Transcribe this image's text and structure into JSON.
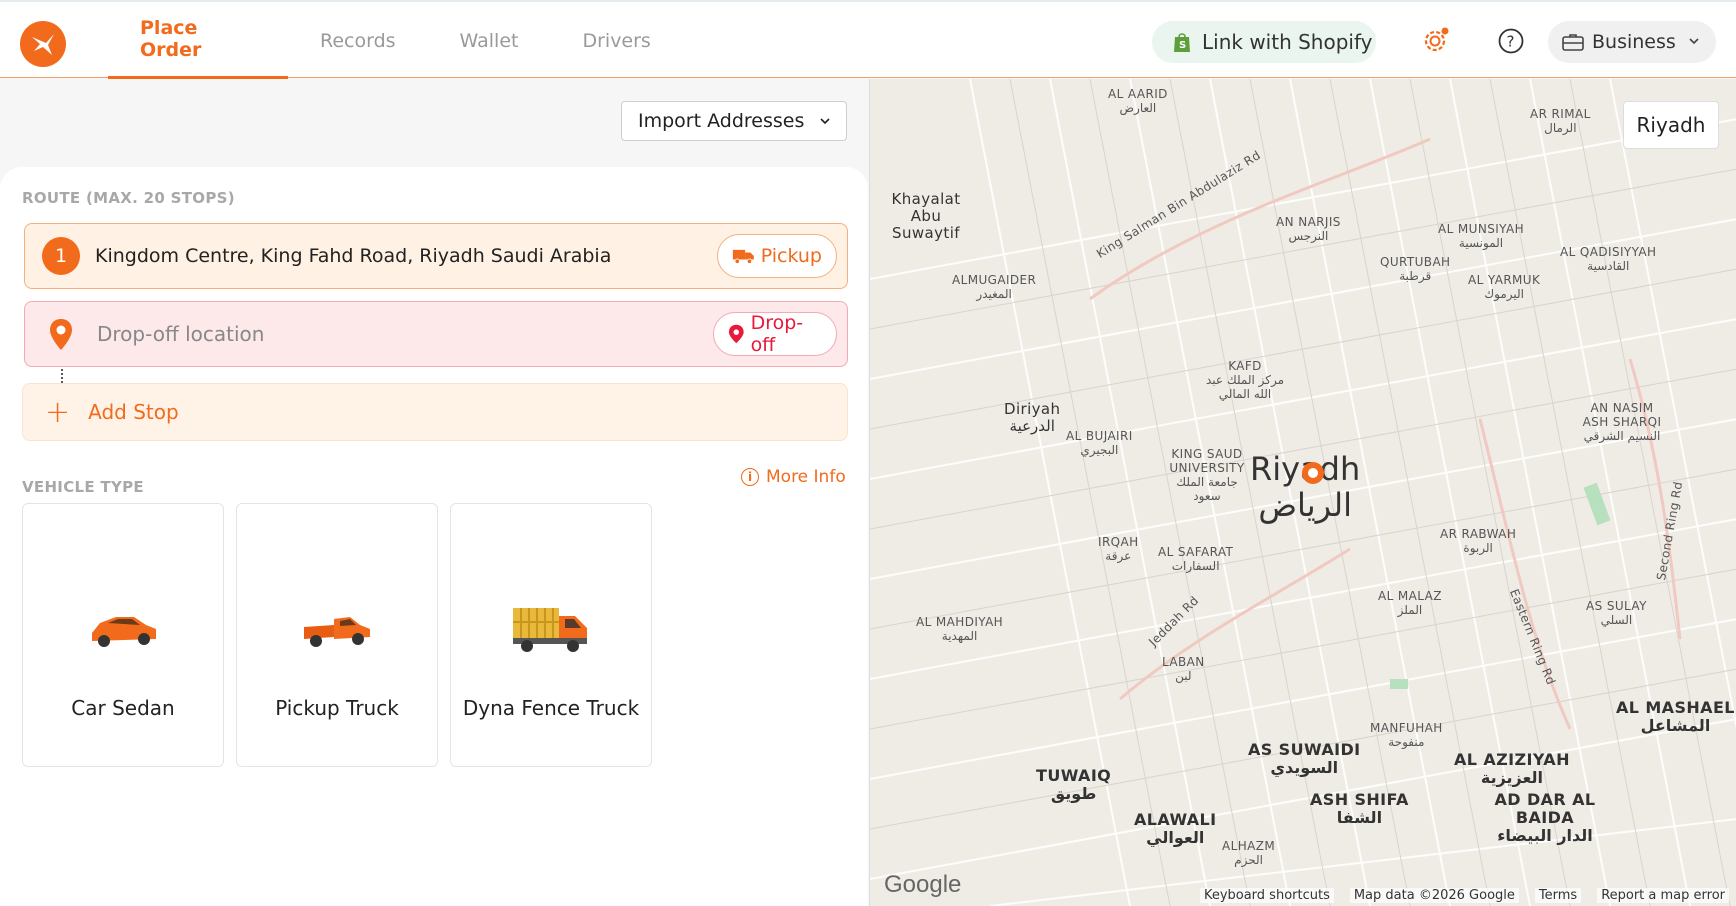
{
  "header": {
    "tabs": [
      {
        "label": "Place Order",
        "active": true
      },
      {
        "label": "Records",
        "active": false
      },
      {
        "label": "Wallet",
        "active": false
      },
      {
        "label": "Drivers",
        "active": false
      }
    ],
    "shopify_label": "Link with Shopify",
    "business_label": "Business",
    "accent": "#f26a1b"
  },
  "left": {
    "import_label": "Import Addresses",
    "route_title": "ROUTE (MAX. 20 STOPS)",
    "pickup_number": "1",
    "pickup_address": "Kingdom Centre, King Fahd Road, Riyadh Saudi Arabia",
    "pickup_tag": "Pickup",
    "dropoff_placeholder": "Drop-off location",
    "dropoff_tag": "Drop-off",
    "add_stop_label": "Add Stop",
    "vehicle_title": "VEHICLE TYPE",
    "more_info_label": "More Info",
    "vehicles": [
      {
        "label": "Car Sedan"
      },
      {
        "label": "Pickup Truck"
      },
      {
        "label": "Dyna Fence Truck"
      }
    ]
  },
  "map": {
    "city_button": "Riyadh",
    "city_name_en": "Riyadh",
    "city_name_ar": "الرياض",
    "labels": [
      {
        "en": "AL AARID",
        "ar": "العارض"
      },
      {
        "en": "AR RIMAL",
        "ar": "الرمال"
      },
      {
        "en": "Khayalat Abu Suwaytif",
        "ar": ""
      },
      {
        "en": "AN NARJIS",
        "ar": "النرجس"
      },
      {
        "en": "AL MUNSIYAH",
        "ar": "المونسية"
      },
      {
        "en": "AL QADISIYYAH",
        "ar": "القادسية"
      },
      {
        "en": "QURTUBAH",
        "ar": "قرطبة"
      },
      {
        "en": "AL YARMUK",
        "ar": "اليرموك"
      },
      {
        "en": "ALMUGAIDER",
        "ar": "المغيدر"
      },
      {
        "en": "KAFD",
        "ar": "مركز الملك عبد الله المالي"
      },
      {
        "en": "Diriyah",
        "ar": "الدرعية"
      },
      {
        "en": "AL BUJAIRI",
        "ar": "البجيري"
      },
      {
        "en": "KING SAUD UNIVERSITY",
        "ar": "جامعة الملك سعود"
      },
      {
        "en": "AN NASIM ASH SHARQI",
        "ar": "النسيم الشرقي"
      },
      {
        "en": "AR RABWAH",
        "ar": "الربوة"
      },
      {
        "en": "IRQAH",
        "ar": "عرقة"
      },
      {
        "en": "AL SAFARAT",
        "ar": "السفارات"
      },
      {
        "en": "AL MALAZ",
        "ar": "الملز"
      },
      {
        "en": "AS SULAY",
        "ar": "السلي"
      },
      {
        "en": "AL MAHDIYAH",
        "ar": "المهدية"
      },
      {
        "en": "LABAN",
        "ar": "لبن"
      },
      {
        "en": "AL MASHAEL",
        "ar": "المشاعل"
      },
      {
        "en": "MANFUHAH",
        "ar": "منفوحة"
      },
      {
        "en": "AS SUWAIDI",
        "ar": "السويدي"
      },
      {
        "en": "AL AZIZIYAH",
        "ar": "العزيزية"
      },
      {
        "en": "TUWAIQ",
        "ar": "طويق"
      },
      {
        "en": "ASH SHIFA",
        "ar": "الشفا"
      },
      {
        "en": "AD DAR AL BAIDA",
        "ar": "الدار البيضاء"
      },
      {
        "en": "ALAWALI",
        "ar": "العوالي"
      },
      {
        "en": "ALHAZM",
        "ar": "الحزم"
      }
    ],
    "roads": [
      "King Salman Bin Abdulaziz Rd",
      "Jeddah Rd",
      "Eastern Ring Rd",
      "Second Ring Rd"
    ],
    "google": "Google",
    "footer": [
      "Keyboard shortcuts",
      "Map data ©2026 Google",
      "Terms",
      "Report a map error"
    ]
  }
}
